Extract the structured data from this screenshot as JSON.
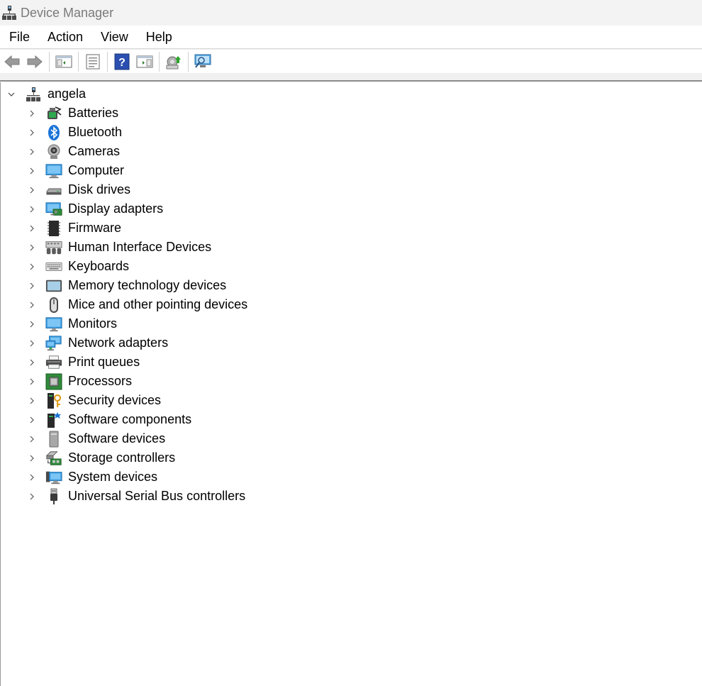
{
  "window": {
    "title": "Device Manager"
  },
  "menu": [
    "File",
    "Action",
    "View",
    "Help"
  ],
  "toolbar": {
    "buttons": [
      "back-icon",
      "forward-icon",
      "show-hide-console-tree-icon",
      "properties-icon",
      "help-icon",
      "action-pane-icon",
      "update-driver-icon",
      "scan-hardware-icon"
    ]
  },
  "tree": {
    "root": {
      "label": "angela",
      "expanded": true
    },
    "items": [
      {
        "label": "Batteries",
        "icon": "battery-icon"
      },
      {
        "label": "Bluetooth",
        "icon": "bluetooth-icon"
      },
      {
        "label": "Cameras",
        "icon": "camera-icon"
      },
      {
        "label": "Computer",
        "icon": "computer-icon"
      },
      {
        "label": "Disk drives",
        "icon": "disk-drive-icon"
      },
      {
        "label": "Display adapters",
        "icon": "display-adapter-icon"
      },
      {
        "label": "Firmware",
        "icon": "firmware-icon"
      },
      {
        "label": "Human Interface Devices",
        "icon": "hid-icon"
      },
      {
        "label": "Keyboards",
        "icon": "keyboard-icon"
      },
      {
        "label": "Memory technology devices",
        "icon": "memory-icon"
      },
      {
        "label": "Mice and other pointing devices",
        "icon": "mouse-icon"
      },
      {
        "label": "Monitors",
        "icon": "monitor-icon"
      },
      {
        "label": "Network adapters",
        "icon": "network-adapter-icon"
      },
      {
        "label": "Print queues",
        "icon": "printer-icon"
      },
      {
        "label": "Processors",
        "icon": "processor-icon"
      },
      {
        "label": "Security devices",
        "icon": "security-device-icon"
      },
      {
        "label": "Software components",
        "icon": "software-component-icon"
      },
      {
        "label": "Software devices",
        "icon": "software-device-icon"
      },
      {
        "label": "Storage controllers",
        "icon": "storage-controller-icon"
      },
      {
        "label": "System devices",
        "icon": "system-device-icon"
      },
      {
        "label": "Universal Serial Bus controllers",
        "icon": "usb-icon"
      }
    ]
  },
  "colors": {
    "accent": "#0a64c8",
    "titlebar_bg": "#f3f3f3",
    "title_text": "#7a7a7a"
  }
}
